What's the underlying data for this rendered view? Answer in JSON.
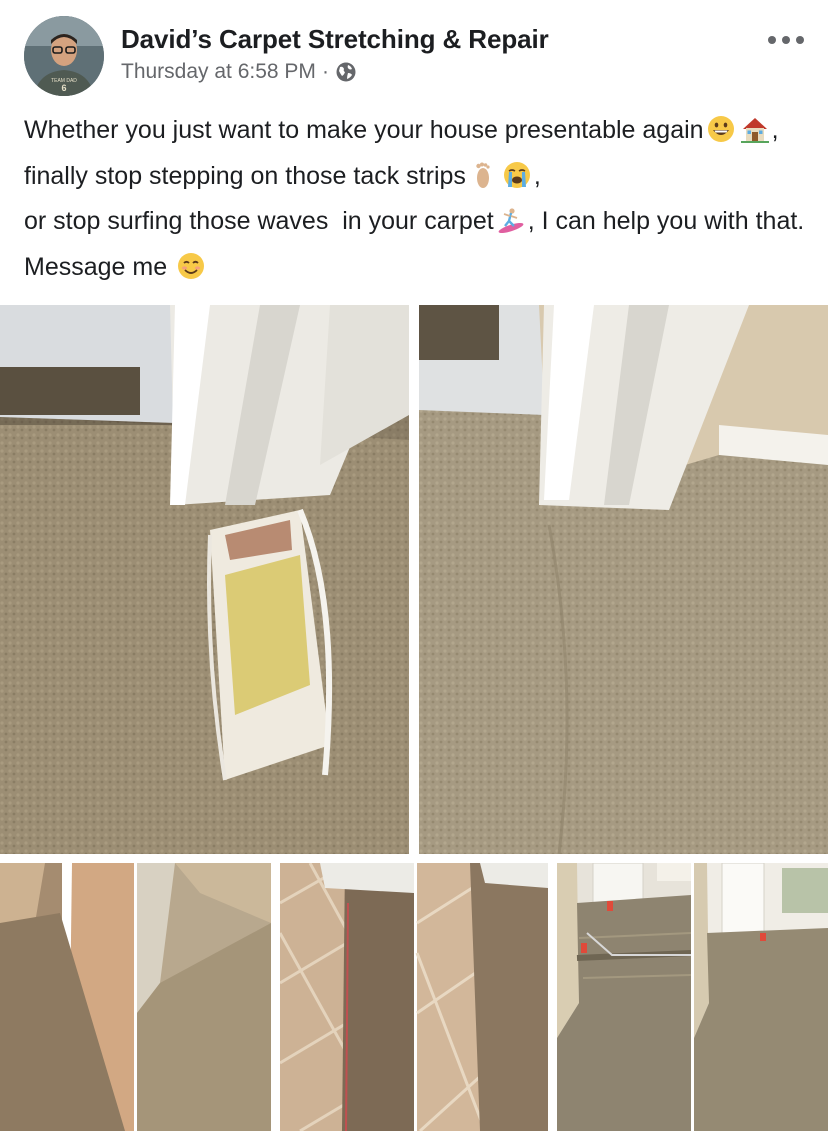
{
  "post": {
    "page_name": "David’s Carpet Stretching & Repair",
    "timestamp": "Thursday at 6:58 PM",
    "separator": "·",
    "privacy_icon": "globe-icon",
    "more_icon": "more-options-icon",
    "text_segments": [
      "Whether you just want to make your house presentable again",
      ", finally stop stepping on those tack strips",
      ",",
      "or stop surfing those waves  in your carpet",
      ", I can help you with that. Message me"
    ],
    "emojis": [
      "grinning-face-emoji",
      "house-emoji",
      "foot-emoji",
      "crying-face-emoji",
      "surfer-emoji",
      "smiling-face-emoji"
    ]
  },
  "avatar": {
    "shirt_text_top": "TEAM DAD",
    "shirt_number": "6"
  },
  "photos": [
    {
      "name": "photo-before-torn-carpet"
    },
    {
      "name": "photo-after-repaired-carpet"
    },
    {
      "name": "photo-hallway-before-after"
    },
    {
      "name": "photo-tile-transition-before-after"
    },
    {
      "name": "photo-stretching-before-after"
    }
  ],
  "colors": {
    "carpet": "#9a8c72",
    "text": "#1c1e21",
    "meta": "#65676b",
    "trim": "#f2f1ec"
  }
}
